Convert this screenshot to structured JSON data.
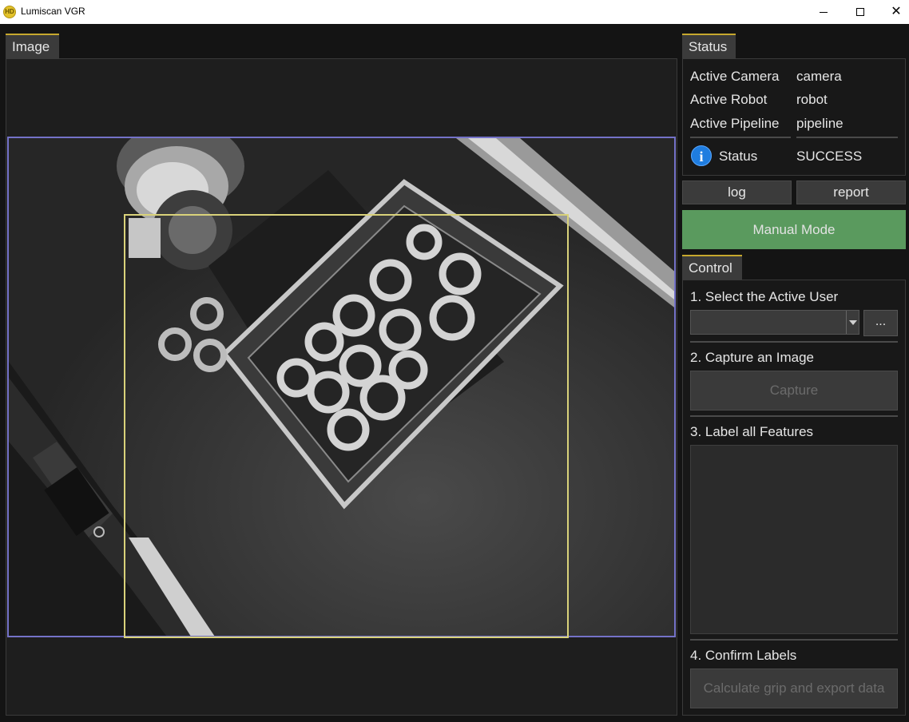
{
  "window": {
    "title": "Lumiscan VGR",
    "icon_label": "HD",
    "controls": [
      "minimize",
      "maximize",
      "close"
    ]
  },
  "image_panel": {
    "tab_label": "Image"
  },
  "status_panel": {
    "tab_label": "Status",
    "rows": [
      {
        "label": "Active Camera",
        "value": "camera"
      },
      {
        "label": "Active Robot",
        "value": "robot"
      },
      {
        "label": "Active Pipeline",
        "value": "pipeline"
      }
    ],
    "status": {
      "label": "Status",
      "value": "SUCCESS",
      "icon": "info-icon"
    },
    "log_button": "log",
    "report_button": "report",
    "mode_button": "Manual Mode"
  },
  "control_panel": {
    "tab_label": "Control",
    "step1_label": "1. Select the Active User",
    "user_select_value": "",
    "browse_button": "...",
    "step2_label": "2. Capture an Image",
    "capture_button": "Capture",
    "step3_label": "3. Label all Features",
    "step4_label": "4. Confirm Labels",
    "export_button": "Calculate grip and export data"
  },
  "colors": {
    "accent_tab": "#c6a82e",
    "outer_roi": "#7472c8",
    "inner_roi": "#d9d27a",
    "manual_mode": "#5a9a5e",
    "info": "#1f7de0"
  }
}
